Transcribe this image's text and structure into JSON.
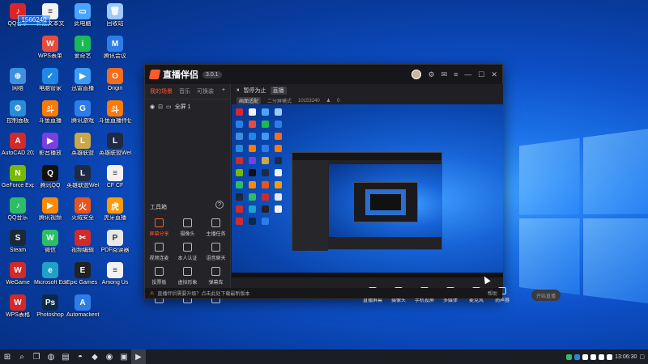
{
  "desktop": {
    "overlay_id": "1566240",
    "icons": [
      {
        "label": "QQ音乐",
        "color": "#d9262b",
        "glyph": "♪"
      },
      {
        "label": "新建文本文",
        "color": "#f2f2f2",
        "glyph": "≡"
      },
      {
        "label": "此电脑",
        "color": "#4aa3ff",
        "glyph": "▭"
      },
      {
        "label": "回收站",
        "color": "#9ec9ff",
        "glyph": "🗑"
      },
      {
        "label": "",
        "color": "#2d7de8",
        "glyph": ""
      },
      {
        "label": "WPS表单",
        "color": "#e84c3d",
        "glyph": "W"
      },
      {
        "label": "爱奇艺",
        "color": "#19b955",
        "glyph": "i"
      },
      {
        "label": "腾讯会议",
        "color": "#2d7de8",
        "glyph": "M"
      },
      {
        "label": "网络",
        "color": "#3d8fe0",
        "glyph": "⊕"
      },
      {
        "label": "电脑管家",
        "color": "#1e88e5",
        "glyph": "✓"
      },
      {
        "label": "迅雷直播",
        "color": "#3c9cf2",
        "glyph": "▶"
      },
      {
        "label": "Origin",
        "color": "#f56c1a",
        "glyph": "O"
      },
      {
        "label": "控制面板",
        "color": "#2a8bd8",
        "glyph": "⚙"
      },
      {
        "label": "斗鱼直播",
        "color": "#ff7a00",
        "glyph": "斗"
      },
      {
        "label": "腾讯游戏",
        "color": "#2d7de8",
        "glyph": "G"
      },
      {
        "label": "斗鱼直播伴侣",
        "color": "#ff7a00",
        "glyph": "斗"
      },
      {
        "label": "AutoCAD 2020",
        "color": "#d12a2a",
        "glyph": "A"
      },
      {
        "label": "影音播放",
        "color": "#7a3fe0",
        "glyph": "▶"
      },
      {
        "label": "英雄联盟",
        "color": "#c8a84a",
        "glyph": "L"
      },
      {
        "label": "英雄联盟WeGame",
        "color": "#1f2a44",
        "glyph": "L"
      },
      {
        "label": "GeForce Experience",
        "color": "#76b900",
        "glyph": "N"
      },
      {
        "label": "腾讯QQ",
        "color": "#111111",
        "glyph": "Q"
      },
      {
        "label": "英雄联盟WeGame版",
        "color": "#1f2a44",
        "glyph": "L"
      },
      {
        "label": "CF CF",
        "color": "#f2f2f2",
        "glyph": "≡"
      },
      {
        "label": "QQ音乐",
        "color": "#2dbd67",
        "glyph": "♪"
      },
      {
        "label": "腾讯视频",
        "color": "#ff8a00",
        "glyph": "▶"
      },
      {
        "label": "火绒安全",
        "color": "#e8541a",
        "glyph": "火"
      },
      {
        "label": "虎牙直播",
        "color": "#ff9a00",
        "glyph": "虎"
      },
      {
        "label": "Steam",
        "color": "#1b2838",
        "glyph": "S"
      },
      {
        "label": "微信",
        "color": "#2dbd67",
        "glyph": "W"
      },
      {
        "label": "视频编辑",
        "color": "#d12a2a",
        "glyph": "✂"
      },
      {
        "label": "PDF阅读器",
        "color": "#e8e8e8",
        "glyph": "P"
      },
      {
        "label": "WeGame",
        "color": "#d12a2a",
        "glyph": "W"
      },
      {
        "label": "Microsoft Edge",
        "color": "#1fa2c9",
        "glyph": "e"
      },
      {
        "label": "Epic Games Launcher",
        "color": "#222222",
        "glyph": "E"
      },
      {
        "label": "Among Us",
        "color": "#f2f2f2",
        "glyph": "≡"
      },
      {
        "label": "WPS表格",
        "color": "#d12a2a",
        "glyph": "W"
      },
      {
        "label": "Photoshop",
        "color": "#0b2a4a",
        "glyph": "Ps"
      },
      {
        "label": "Automaclient",
        "color": "#2d7de8",
        "glyph": "A"
      },
      {
        "label": "",
        "color": "",
        "glyph": ""
      }
    ]
  },
  "app": {
    "title": "直播伴侣",
    "version": "3.0.1",
    "titlebar_icons": [
      "avatar",
      "settings-icon",
      "mail-icon",
      "menu-icon",
      "minimize-icon",
      "maximize-icon",
      "close-icon"
    ],
    "left_tabs": [
      "我的场景",
      "音乐",
      "可换装"
    ],
    "add_label": "+",
    "scene_label": "全屏 1",
    "toolbox_title": "工具箱",
    "help_label": "?",
    "tools": [
      {
        "label": "屏幕分享",
        "active": true
      },
      {
        "label": "摄像头",
        "active": false
      },
      {
        "label": "主播任务",
        "active": false
      },
      {
        "label": "视频连麦",
        "active": false
      },
      {
        "label": "本人认证",
        "active": false
      },
      {
        "label": "语音聊天",
        "active": false
      },
      {
        "label": "投票板",
        "active": false
      },
      {
        "label": "虚拟形象",
        "active": false
      },
      {
        "label": "弹幕库",
        "active": false
      },
      {
        "label": "",
        "active": false
      },
      {
        "label": "",
        "active": false
      },
      {
        "label": "",
        "active": false
      }
    ],
    "main_head": {
      "pause_label": "暂停为止",
      "tag": "直播",
      "line2_left": "画面适配",
      "line2_mid": "二分屏模式",
      "line2_num": "10153240",
      "line2_count": "0"
    },
    "bottom_bar": [
      {
        "label": "直播屏幕"
      },
      {
        "label": "摄像头"
      },
      {
        "label": "手机投屏"
      },
      {
        "label": "多媒体"
      },
      {
        "label": "麦克风"
      },
      {
        "label": "扬声器"
      }
    ],
    "start_live_label": "开始直播",
    "status_warn": "直播伴侣需要升级？点击此处下载最新版本",
    "status_right": "帮助"
  },
  "taskbar": {
    "items": [
      "start-icon",
      "search-icon",
      "taskview-icon",
      "wechat-icon",
      "explorer-icon",
      "qq-icon",
      "app-icon",
      "steam-icon",
      "app2-icon",
      "livecompanion-icon"
    ],
    "time": "13:06:30",
    "tray_colors": [
      "#2dbd67",
      "#1e88e5",
      "#ffffff",
      "#ffffff",
      "#ffffff",
      "#ffffff"
    ]
  }
}
